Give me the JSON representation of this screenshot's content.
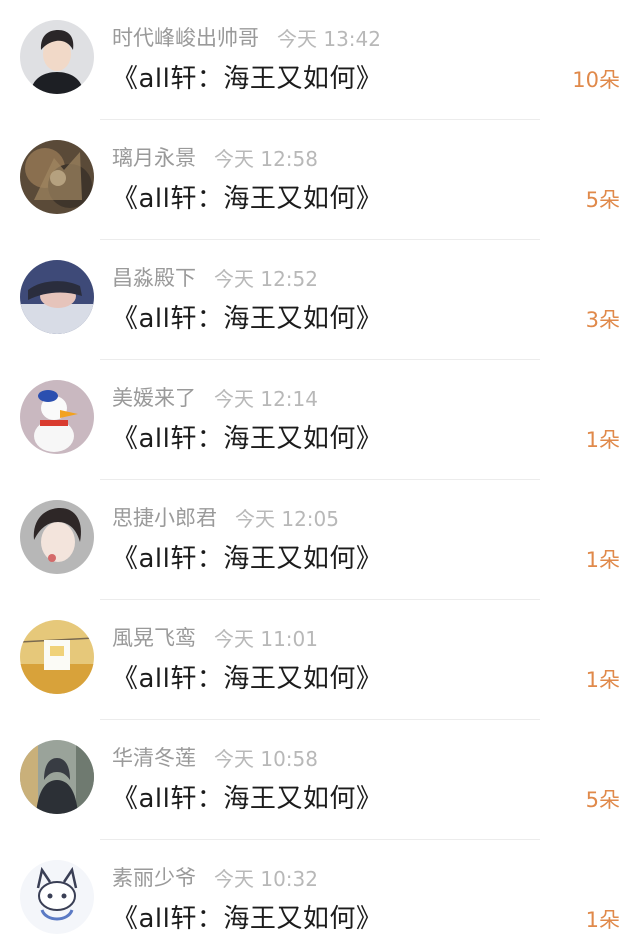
{
  "rows": [
    {
      "username": "时代峰峻出帅哥",
      "time": "今天 13:42",
      "title": "《all轩：海王又如何》",
      "count": "10朵",
      "avatar": "avatar-boy-black-hoodie"
    },
    {
      "username": "璃月永景",
      "time": "今天 12:58",
      "title": "《all轩：海王又如何》",
      "count": "5朵",
      "avatar": "avatar-fantasy-art"
    },
    {
      "username": "昌淼殿下",
      "time": "今天 12:52",
      "title": "《all轩：海王又如何》",
      "count": "3朵",
      "avatar": "avatar-person-lying"
    },
    {
      "username": "美媛来了",
      "time": "今天 12:14",
      "title": "《all轩：海王又如何》",
      "count": "1朵",
      "avatar": "avatar-donald-duck"
    },
    {
      "username": "思捷小郎君",
      "time": "今天 12:05",
      "title": "《all轩：海王又如何》",
      "count": "1朵",
      "avatar": "avatar-girl-portrait"
    },
    {
      "username": "風晃飞鸾",
      "time": "今天 11:01",
      "title": "《all轩：海王又如何》",
      "count": "1朵",
      "avatar": "avatar-laundry-field"
    },
    {
      "username": "华清冬莲",
      "time": "今天 10:58",
      "title": "《all轩：海王又如何》",
      "count": "5朵",
      "avatar": "avatar-hooded-figure"
    },
    {
      "username": "素丽少爷",
      "time": "今天 10:32",
      "title": "《all轩：海王又如何》",
      "count": "1朵",
      "avatar": "avatar-anime-cat-sketch"
    }
  ],
  "colors": {
    "username": "#9a9a9a",
    "time": "#b8b8b8",
    "count": "#e0894a",
    "title": "#1c1c1c"
  }
}
